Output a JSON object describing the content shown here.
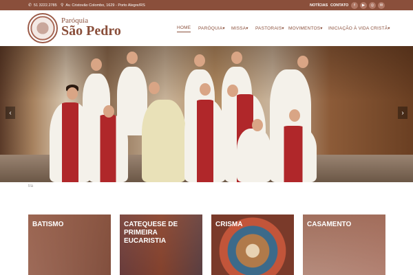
{
  "topbar": {
    "phone": "51 3222.2785",
    "address": "Av. Cristovão Colombo, 1629 - Porto Alegre/RS",
    "links": [
      "NOTÍCIAS",
      "CONTATO"
    ],
    "social_icons": [
      "facebook-icon",
      "youtube-icon",
      "instagram-icon",
      "email-icon"
    ]
  },
  "logo": {
    "line1": "Paróquia",
    "line2": "São Pedro"
  },
  "nav": {
    "items": [
      "HOME",
      "PARÓQUIA▾",
      "MISSA▾",
      "PASTORAIS▾",
      "MOVIMENTOS▾",
      "INICIAÇÃO À VIDA CRISTÃ▾"
    ],
    "active": "HOME"
  },
  "hero": {
    "caption": "tra"
  },
  "cards": [
    {
      "title": "BATISMO"
    },
    {
      "title": "CATEQUESE DE PRIMEIRA EUCARISTIA"
    },
    {
      "title": "CRISMA"
    },
    {
      "title": "CASAMENTO"
    }
  ],
  "colors": {
    "brand": "#8a4f3b",
    "topbar": "#8a4f3b",
    "social_bg": "#b07866"
  }
}
